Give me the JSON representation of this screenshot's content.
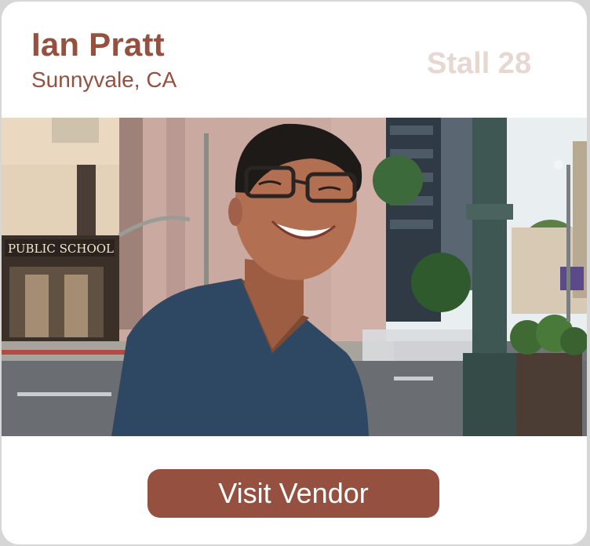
{
  "vendor": {
    "name": "Ian Pratt",
    "location": "Sunnyvale, CA",
    "stall": "Stall 28"
  },
  "photo": {
    "storefront_sign": "PUBLIC SCHOOL"
  },
  "actions": {
    "visit_label": "Visit Vendor"
  },
  "colors": {
    "brand": "#96503f",
    "stall_text": "#e6d7d1",
    "button_text": "#ffffff",
    "card_background": "#ffffff"
  }
}
